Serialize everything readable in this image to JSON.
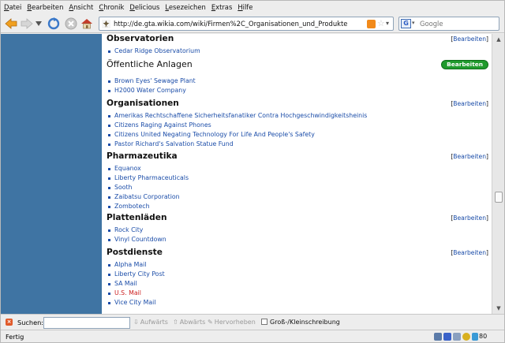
{
  "menubar": {
    "items": [
      "Datei",
      "Bearbeiten",
      "Ansicht",
      "Chronik",
      "Delicious",
      "Lesezeichen",
      "Extras",
      "Hilfe"
    ]
  },
  "navbar": {
    "url": "http://de.gta.wikia.com/wiki/Firmen%2C_Organisationen_und_Produkte",
    "search_placeholder": "Google",
    "engine_letter": "G"
  },
  "article": {
    "edit_link": "Bearbeiten",
    "edit_button": "Bearbeiten",
    "sections": [
      {
        "title": "Observatorien",
        "edit": "link",
        "items": [
          {
            "text": "Cedar Ridge Observatorium"
          }
        ]
      },
      {
        "title": "Öffentliche Anlagen",
        "edit": "button",
        "items": [
          {
            "text": "Brown Eyes' Sewage Plant"
          },
          {
            "text": "H2000 Water Company"
          }
        ]
      },
      {
        "title": "Organisationen",
        "edit": "link",
        "items": [
          {
            "text": "Amerikas Rechtschaffene Sicherheitsfanatiker Contra Hochgeschwindigkeitsheinis"
          },
          {
            "text": "Citizens Raging Against Phones"
          },
          {
            "text": "Citizens United Negating Technology For Life And People's Safety"
          },
          {
            "text": "Pastor Richard's Salvation Statue Fund"
          }
        ]
      },
      {
        "title": "Pharmazeutika",
        "edit": "link",
        "items": [
          {
            "text": "Equanox"
          },
          {
            "text": "Liberty Pharmaceuticals"
          },
          {
            "text": "Sooth"
          },
          {
            "text": "Zaibatsu Corporation"
          },
          {
            "text": "Zombotech"
          }
        ]
      },
      {
        "title": "Plattenläden",
        "edit": "link",
        "items": [
          {
            "text": "Rock City"
          },
          {
            "text": "Vinyl Countdown"
          }
        ]
      },
      {
        "title": "Postdienste",
        "edit": "link",
        "items": [
          {
            "text": "Alpha Mail"
          },
          {
            "text": "Liberty City Post"
          },
          {
            "text": "SA Mail"
          },
          {
            "text": "U.S. Mail",
            "red": true
          },
          {
            "text": "Vice City Mail"
          }
        ]
      }
    ]
  },
  "findbar": {
    "label": "Suchen:",
    "next": "Aufwärts",
    "prev": "Abwärts",
    "highlight": "Hervorheben",
    "match_case": "Groß-/Kleinschreibung"
  },
  "statusbar": {
    "text": "Fertig",
    "count": "80"
  },
  "colors": {
    "left_panel": "#3f74a3",
    "link": "#1a4ca8",
    "red_link": "#cc2020",
    "edit_button": "#1f9a2c"
  }
}
